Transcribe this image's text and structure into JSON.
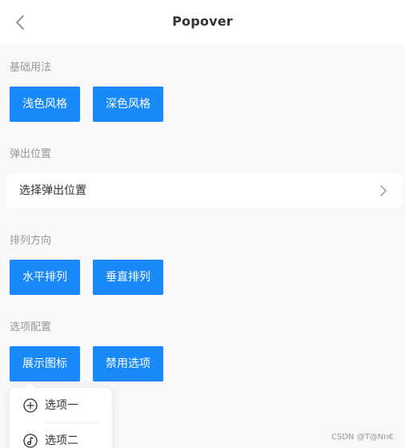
{
  "nav": {
    "title": "Popover",
    "back_icon": "chevron-left-icon"
  },
  "sections": {
    "basic": {
      "title": "基础用法",
      "buttons": [
        "浅色风格",
        "深色风格"
      ]
    },
    "placement": {
      "title": "弹出位置",
      "cell_label": "选择弹出位置",
      "cell_icon": "chevron-right-icon"
    },
    "direction": {
      "title": "排列方向",
      "buttons": [
        "水平排列",
        "垂直排列"
      ]
    },
    "options": {
      "title": "选项配置",
      "buttons": [
        "展示图标",
        "禁用选项"
      ]
    }
  },
  "popover": {
    "items": [
      {
        "label": "选项一",
        "icon": "add-circle-icon"
      },
      {
        "label": "选项二",
        "icon": "music-icon"
      }
    ]
  },
  "watermark": "CSDN @T@Nn€",
  "colors": {
    "primary": "#1989fa",
    "background": "#f7f8fa",
    "text": "#323233",
    "muted": "#969799"
  }
}
